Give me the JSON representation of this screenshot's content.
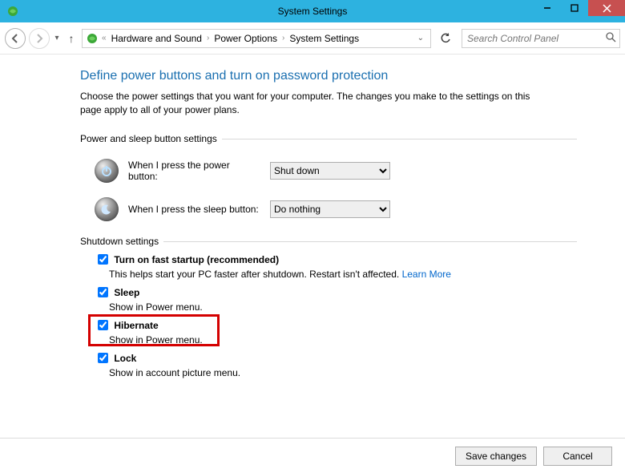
{
  "window": {
    "title": "System Settings"
  },
  "breadcrumb": {
    "items": [
      "Hardware and Sound",
      "Power Options",
      "System Settings"
    ]
  },
  "search": {
    "placeholder": "Search Control Panel"
  },
  "page": {
    "heading": "Define power buttons and turn on password protection",
    "description": "Choose the power settings that you want for your computer. The changes you make to the settings on this page apply to all of your power plans."
  },
  "section_power": {
    "label": "Power and sleep button settings",
    "rows": [
      {
        "label": "When I press the power button:",
        "selected": "Shut down"
      },
      {
        "label": "When I press the sleep button:",
        "selected": "Do nothing"
      }
    ]
  },
  "section_shutdown": {
    "label": "Shutdown settings",
    "items": [
      {
        "title": "Turn on fast startup (recommended)",
        "desc_prefix": "This helps start your PC faster after shutdown. Restart isn't affected. ",
        "link": "Learn More",
        "checked": true
      },
      {
        "title": "Sleep",
        "desc": "Show in Power menu.",
        "checked": true
      },
      {
        "title": "Hibernate",
        "desc": "Show in Power menu.",
        "checked": true,
        "highlighted": true
      },
      {
        "title": "Lock",
        "desc": "Show in account picture menu.",
        "checked": true
      }
    ]
  },
  "footer": {
    "save": "Save changes",
    "cancel": "Cancel"
  }
}
